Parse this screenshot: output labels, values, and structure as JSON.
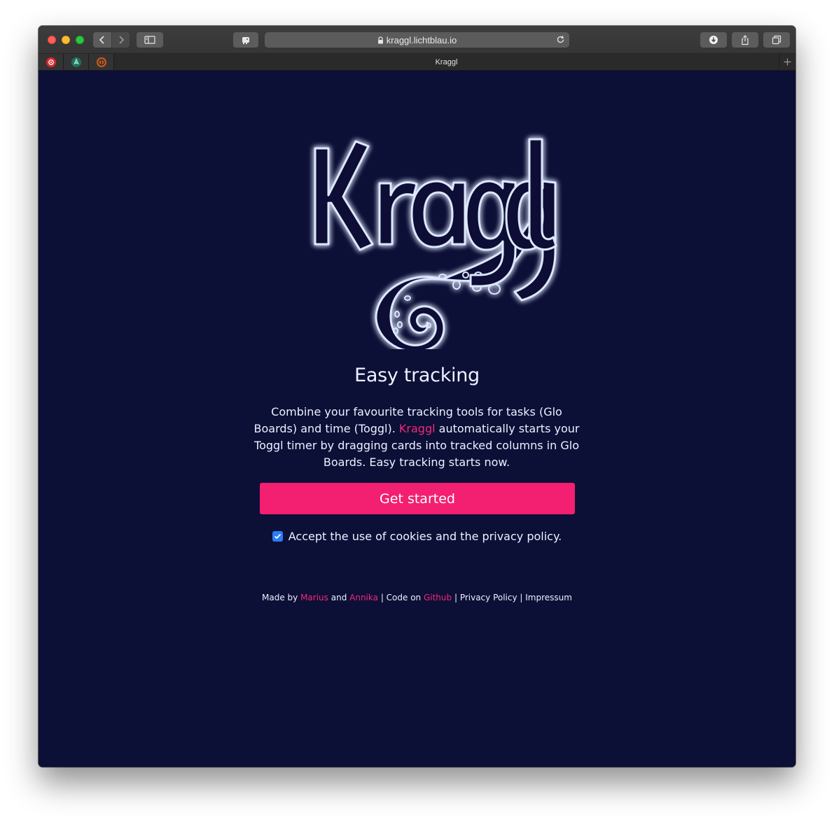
{
  "browser": {
    "url": "kraggl.lichtblau.io",
    "tab_title": "Kraggl",
    "pinned_tabs": [
      "pinned-tab-1",
      "pinned-tab-2",
      "pinned-tab-3"
    ]
  },
  "page": {
    "logo_text": "Kraggl",
    "headline": "Easy tracking",
    "description": {
      "part1": "Combine your favourite tracking tools for tasks (Glo Boards) and time (Toggl). ",
      "link": "Kraggl",
      "part2": " automatically starts your Toggl timer by dragging cards into tracked columns in Glo Boards. Easy tracking starts now."
    },
    "cta_label": "Get started",
    "consent_label": "Accept the use of cookies and the privacy policy.",
    "consent_checked": true,
    "footer": {
      "made_by": "Made by ",
      "author1": "Marius",
      "and": " and ",
      "author2": "Annika",
      "sep1": " | Code on ",
      "code_link": "Github",
      "sep2": " | ",
      "privacy": "Privacy Policy",
      "sep3": " | ",
      "impressum": "Impressum"
    }
  },
  "colors": {
    "background": "#0c0f36",
    "accent": "#f31f70",
    "checkbox": "#2b7cf6",
    "text": "#eef1ff"
  }
}
